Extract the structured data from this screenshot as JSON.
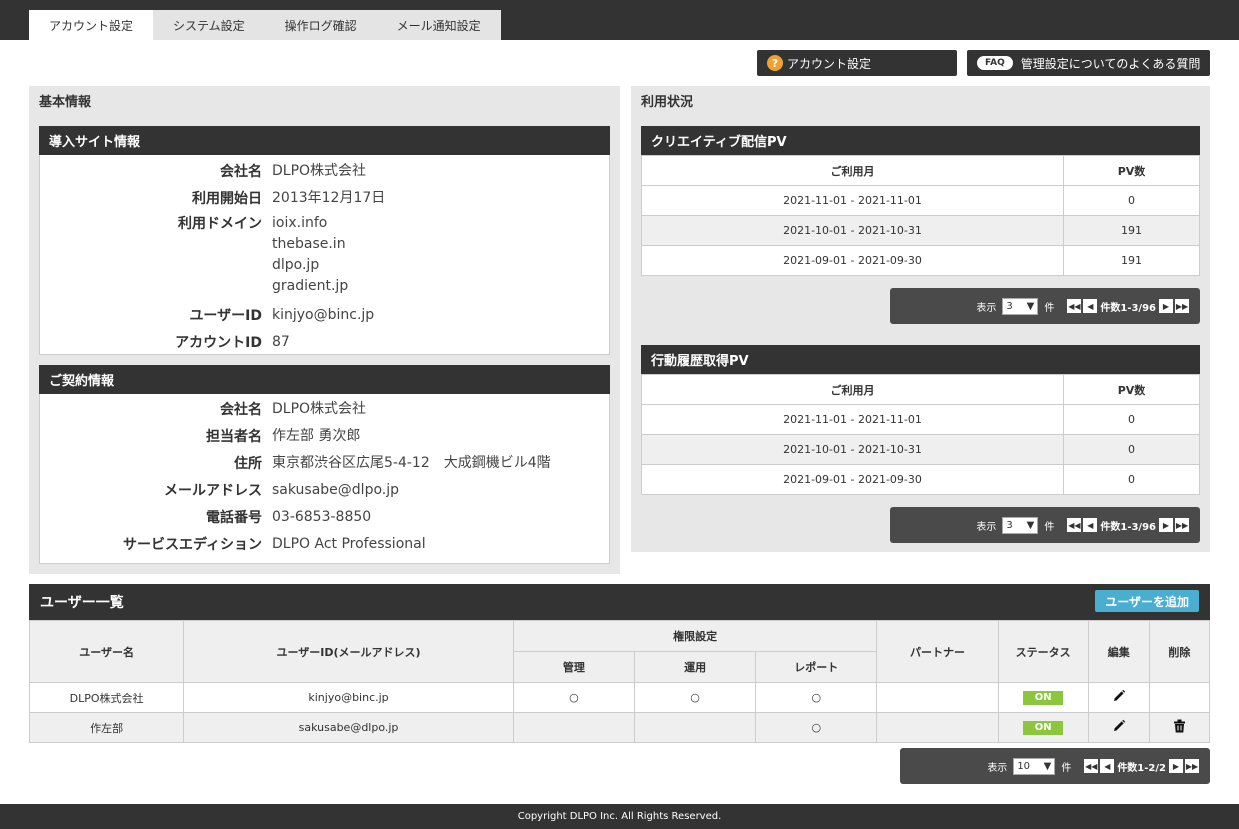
{
  "tabs": [
    "アカウント設定",
    "システム設定",
    "操作ログ確認",
    "メール通知設定"
  ],
  "help": {
    "account_label": "アカウント設定",
    "faq_badge": "FAQ",
    "faq_label": "管理設定についてのよくある質問"
  },
  "basic": {
    "title": "基本情報",
    "site": {
      "heading": "導入サイト情報",
      "rows": [
        {
          "k": "会社名",
          "v": "DLPO株式会社"
        },
        {
          "k": "利用開始日",
          "v": "2013年12月17日"
        },
        {
          "k": "ユーザーID",
          "v": "kinjyo@binc.jp"
        },
        {
          "k": "アカウントID",
          "v": "87"
        }
      ],
      "domain_label": "利用ドメイン",
      "domains": [
        "ioix.info",
        "thebase.in",
        "dlpo.jp",
        "gradient.jp"
      ]
    },
    "contract": {
      "heading": "ご契約情報",
      "rows": [
        {
          "k": "会社名",
          "v": "DLPO株式会社"
        },
        {
          "k": "担当者名",
          "v": "作左部 勇次郎"
        },
        {
          "k": "住所",
          "v": "東京都渋谷区広尾5-4-12　大成鋼機ビル4階"
        },
        {
          "k": "メールアドレス",
          "v": "sakusabe@dlpo.jp"
        },
        {
          "k": "電話番号",
          "v": "03-6853-8850"
        },
        {
          "k": "サービスエディション",
          "v": "DLPO Act Professional"
        }
      ]
    }
  },
  "usage": {
    "title": "利用状況",
    "creative": {
      "heading": "クリエイティブ配信PV",
      "col_month": "ご利用月",
      "col_pv": "PV数",
      "rows": [
        {
          "month": "2021-11-01 - 2021-11-01",
          "pv": "0"
        },
        {
          "month": "2021-10-01 - 2021-10-31",
          "pv": "191"
        },
        {
          "month": "2021-09-01 - 2021-09-30",
          "pv": "191"
        }
      ],
      "pager": {
        "show": "表示",
        "size": "3",
        "unit": "件",
        "count": "件数1-3/96"
      }
    },
    "behavior": {
      "heading": "行動履歴取得PV",
      "col_month": "ご利用月",
      "col_pv": "PV数",
      "rows": [
        {
          "month": "2021-11-01 - 2021-11-01",
          "pv": "0"
        },
        {
          "month": "2021-10-01 - 2021-10-31",
          "pv": "0"
        },
        {
          "month": "2021-09-01 - 2021-09-30",
          "pv": "0"
        }
      ],
      "pager": {
        "show": "表示",
        "size": "3",
        "unit": "件",
        "count": "件数1-3/96"
      }
    }
  },
  "users": {
    "title": "ユーザー一覧",
    "add_label": "ユーザーを追加",
    "cols": {
      "name": "ユーザー名",
      "id": "ユーザーID(メールアドレス)",
      "perm": "権限設定",
      "admin": "管理",
      "ops": "運用",
      "report": "レポート",
      "partner": "パートナー",
      "status": "ステータス",
      "edit": "編集",
      "delete": "削除"
    },
    "rows": [
      {
        "name": "DLPO株式会社",
        "id": "kinjyo@binc.jp",
        "admin": "○",
        "ops": "○",
        "report": "○",
        "partner": "",
        "status": "ON",
        "deletable": false
      },
      {
        "name": "作左部",
        "id": "sakusabe@dlpo.jp",
        "admin": "",
        "ops": "",
        "report": "○",
        "partner": "",
        "status": "ON",
        "deletable": true
      }
    ],
    "pager": {
      "show": "表示",
      "size": "10",
      "unit": "件",
      "count": "件数1-2/2"
    }
  },
  "footer": "Copyright DLPO Inc. All Rights Reserved.",
  "icons": {
    "edit": "pencil-icon",
    "delete": "trash-icon",
    "help": "question-icon"
  }
}
